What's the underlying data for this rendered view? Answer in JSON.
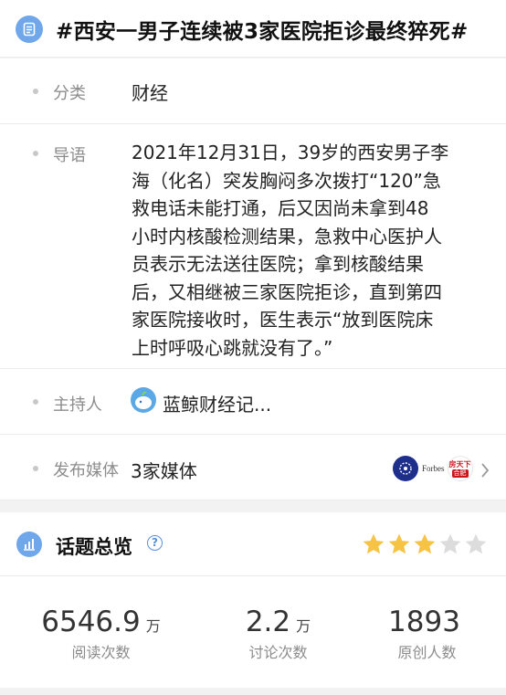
{
  "header": {
    "title": "#西安一男子连续被3家医院拒诊最终猝死#",
    "icon": "document-icon"
  },
  "info": {
    "category": {
      "label": "分类",
      "value": "财经"
    },
    "intro": {
      "label": "导语",
      "lines": [
        "2021年12月31日，39岁的西安男子李",
        "海（化名）突发胸闷多次拨打“120”急",
        "救电话未能打通，后又因尚未拿到48",
        "小时内核酸检测结果，急救中心医护人",
        "员表示无法送往医院；拿到核酸结果",
        "后，又相继被三家医院拒诊，直到第四",
        "家医院接收时，医生表示“放到医院床",
        "上时呼吸心跳就没有了。”"
      ]
    },
    "host": {
      "label": "主持人",
      "value": "蓝鲸财经记..."
    },
    "media": {
      "label": "发布媒体",
      "value": "3家媒体",
      "logos": {
        "forbes": "Forbes",
        "fang_top": "房天下",
        "fang_bottom": "合肥"
      }
    }
  },
  "overview": {
    "title": "话题总览",
    "rating": {
      "filled": 3,
      "total": 5
    },
    "colors": {
      "star_on": "#f6c344",
      "star_off": "#dcdcdc",
      "accent": "#6fa7ea"
    }
  },
  "stats": [
    {
      "value": "6546.9",
      "unit": "万",
      "caption": "阅读次数"
    },
    {
      "value": "2.2",
      "unit": "万",
      "caption": "讨论次数"
    },
    {
      "value": "1893",
      "unit": "",
      "caption": "原创人数"
    }
  ]
}
